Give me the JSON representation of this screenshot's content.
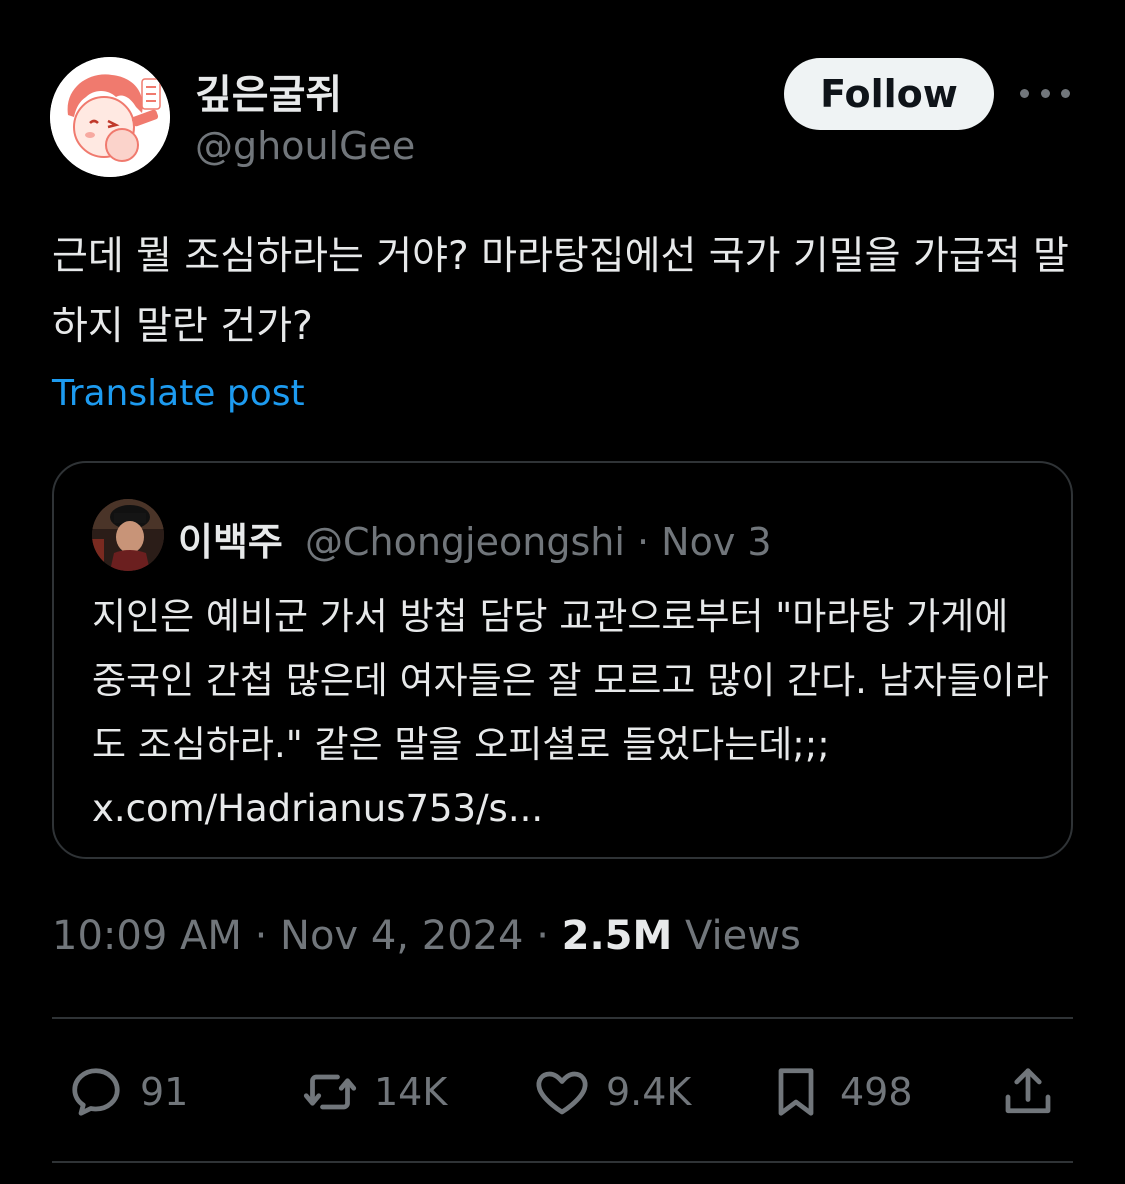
{
  "author": {
    "display_name": "깊은굴쥐",
    "handle": "@ghoulGee"
  },
  "header": {
    "follow_label": "Follow",
    "more_icon": "more-horizontal-icon"
  },
  "post": {
    "text": "근데 뭘 조심하라는 거야? 마라탕집에선 국가 기밀을 가급적 말하지 말란 건가?",
    "translate_label": "Translate post",
    "time": "10:09 AM",
    "date": "Nov 4, 2024",
    "views_count": "2.5M",
    "views_label": "Views",
    "separator": "·"
  },
  "quote": {
    "display_name": "이백주",
    "handle": "@Chongjeongshi",
    "date": "Nov 3",
    "text": "지인은 예비군 가서 방첩 담당 교관으로부터 \"마라탕 가게에 중국인 간첩 많은데 여자들은 잘 모르고 많이 간다. 남자들이라도 조심하라.\" 같은 말을 오피셜로 들었다는데;;; x.com/Hadrianus753/s..."
  },
  "actions": {
    "replies": "91",
    "reposts": "14K",
    "likes": "9.4K",
    "bookmarks": "498"
  },
  "colors": {
    "background": "#000000",
    "text": "#e7e9ea",
    "muted": "#71767b",
    "link": "#1d9bf0",
    "border": "#2f3336"
  }
}
